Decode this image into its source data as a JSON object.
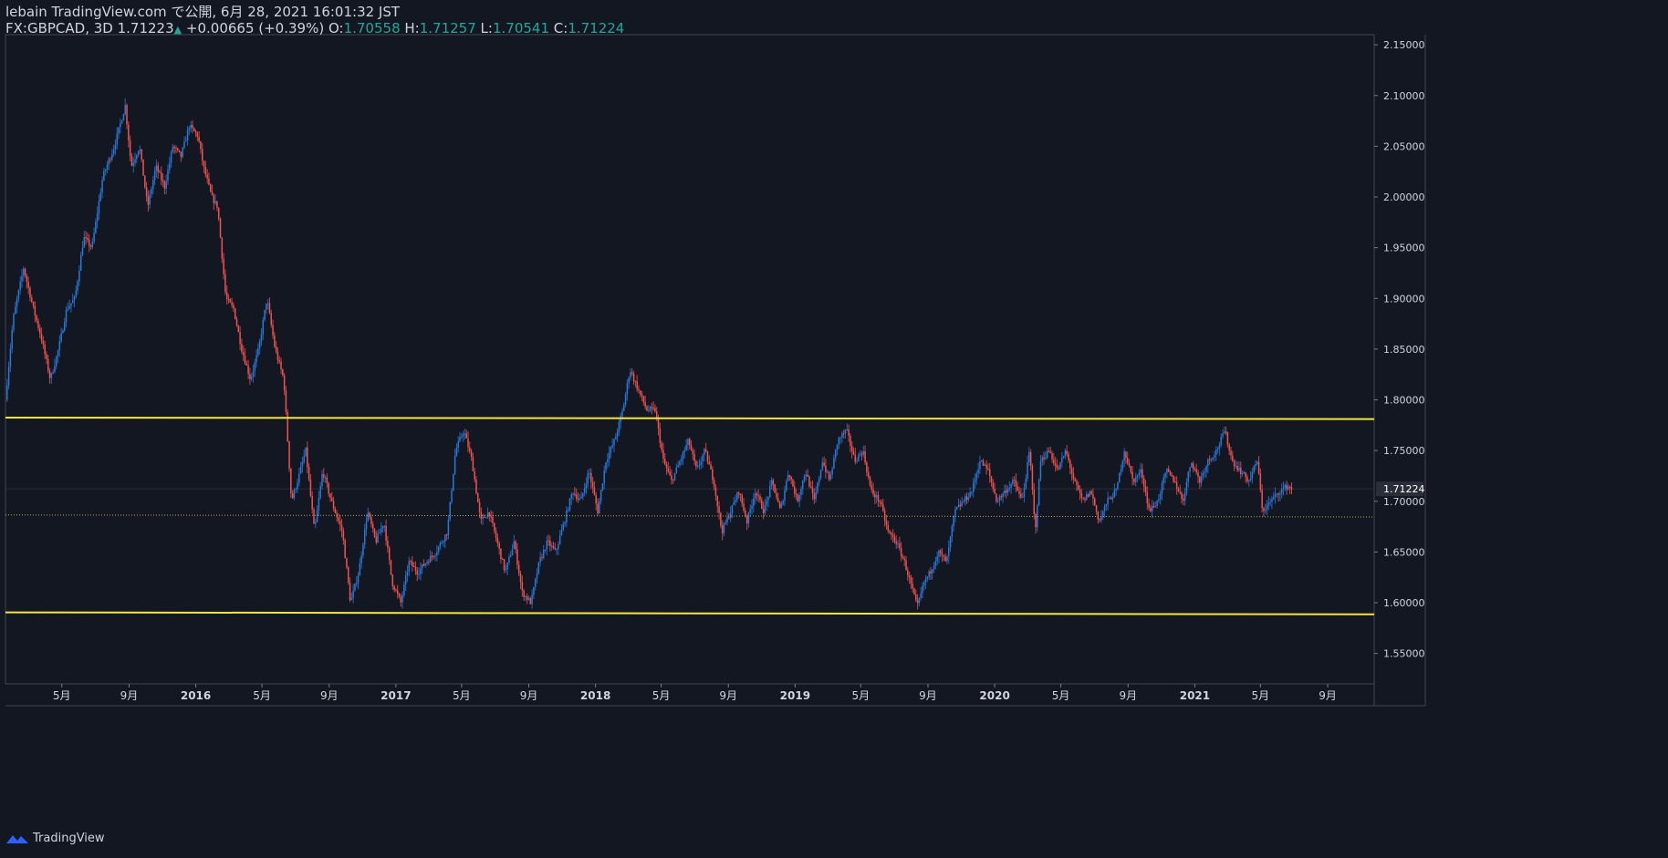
{
  "header": {
    "line1": "lebain TradingView.com で公開, 6月 28, 2021 16:01:32 JST",
    "symbol": "FX:GBPCAD, 3D 1.71223",
    "change": "+0.00665 (+0.39%)",
    "o_label": "O:",
    "o_value": "1.70558",
    "h_label": "H:",
    "h_value": "1.71257",
    "l_label": "L:",
    "l_value": "1.70541",
    "c_label": "C:",
    "c_value": "1.71224"
  },
  "footer": {
    "brand": "TradingView"
  },
  "colors": {
    "background": "#131722",
    "up": "#2979d8",
    "down": "#ef5350",
    "level_line": "#f5e642",
    "axis_text": "#d1d4dc",
    "price_tag": "#2a2e39"
  },
  "chart_data": {
    "type": "candlestick",
    "title": "",
    "symbol": "FX:GBPCAD",
    "timeframe": "3D",
    "ylim": [
      1.52,
      2.16
    ],
    "y_ticks": [
      1.55,
      1.6,
      1.65,
      1.7,
      1.75,
      1.8,
      1.85,
      1.9,
      1.95,
      2.0,
      2.05,
      2.1,
      2.15
    ],
    "y_tick_labels": [
      "1.55000",
      "1.60000",
      "1.65000",
      "1.70000",
      "1.75000",
      "1.80000",
      "1.85000",
      "1.90000",
      "1.95000",
      "2.00000",
      "2.05000",
      "2.10000",
      "2.15000"
    ],
    "xlim": [
      "2015-01-18",
      "2021-11-25"
    ],
    "x_ticks": [
      {
        "date": "2015-05-01",
        "label": "5月"
      },
      {
        "date": "2015-09-01",
        "label": "9月"
      },
      {
        "date": "2016-01-01",
        "label": "2016"
      },
      {
        "date": "2016-05-01",
        "label": "5月"
      },
      {
        "date": "2016-09-01",
        "label": "9月"
      },
      {
        "date": "2017-01-01",
        "label": "2017"
      },
      {
        "date": "2017-05-01",
        "label": "5月"
      },
      {
        "date": "2017-09-01",
        "label": "9月"
      },
      {
        "date": "2018-01-01",
        "label": "2018"
      },
      {
        "date": "2018-05-01",
        "label": "5月"
      },
      {
        "date": "2018-09-01",
        "label": "9月"
      },
      {
        "date": "2019-01-01",
        "label": "2019"
      },
      {
        "date": "2019-05-01",
        "label": "5月"
      },
      {
        "date": "2019-09-01",
        "label": "9月"
      },
      {
        "date": "2020-01-01",
        "label": "2020"
      },
      {
        "date": "2020-05-01",
        "label": "5月"
      },
      {
        "date": "2020-09-01",
        "label": "9月"
      },
      {
        "date": "2021-01-01",
        "label": "2021"
      },
      {
        "date": "2021-05-01",
        "label": "5月"
      },
      {
        "date": "2021-09-01",
        "label": "9月"
      }
    ],
    "last_price": 1.71224,
    "last_price_label": "1.71224",
    "horizontal_levels": [
      {
        "price": 1.7825,
        "end_price": 1.781,
        "style": "solid",
        "color": "#f5e642"
      },
      {
        "price": 1.5905,
        "end_price": 1.5885,
        "style": "solid",
        "color": "#f5e642"
      },
      {
        "price": 1.6865,
        "end_price": 1.6845,
        "style": "dotted",
        "color": "#b8a94a"
      }
    ],
    "close_path": [
      [
        "2015-01-18",
        1.8
      ],
      [
        "2015-02-01",
        1.88
      ],
      [
        "2015-02-20",
        1.93
      ],
      [
        "2015-03-10",
        1.89
      ],
      [
        "2015-03-25",
        1.86
      ],
      [
        "2015-04-10",
        1.82
      ],
      [
        "2015-04-25",
        1.85
      ],
      [
        "2015-05-10",
        1.89
      ],
      [
        "2015-05-25",
        1.9
      ],
      [
        "2015-06-10",
        1.96
      ],
      [
        "2015-06-25",
        1.95
      ],
      [
        "2015-07-15",
        2.02
      ],
      [
        "2015-08-05",
        2.05
      ],
      [
        "2015-08-25",
        2.09
      ],
      [
        "2015-09-05",
        2.03
      ],
      [
        "2015-09-20",
        2.05
      ],
      [
        "2015-10-05",
        1.99
      ],
      [
        "2015-10-20",
        2.03
      ],
      [
        "2015-11-05",
        2.01
      ],
      [
        "2015-11-20",
        2.05
      ],
      [
        "2015-12-05",
        2.04
      ],
      [
        "2015-12-20",
        2.07
      ],
      [
        "2016-01-05",
        2.06
      ],
      [
        "2016-01-15",
        2.03
      ],
      [
        "2016-01-30",
        2.0
      ],
      [
        "2016-02-10",
        1.99
      ],
      [
        "2016-02-25",
        1.9
      ],
      [
        "2016-03-10",
        1.89
      ],
      [
        "2016-03-25",
        1.85
      ],
      [
        "2016-04-10",
        1.82
      ],
      [
        "2016-04-25",
        1.85
      ],
      [
        "2016-05-10",
        1.9
      ],
      [
        "2016-05-25",
        1.85
      ],
      [
        "2016-06-10",
        1.82
      ],
      [
        "2016-06-24",
        1.7
      ],
      [
        "2016-07-05",
        1.72
      ],
      [
        "2016-07-20",
        1.75
      ],
      [
        "2016-08-05",
        1.67
      ],
      [
        "2016-08-20",
        1.73
      ],
      [
        "2016-09-05",
        1.7
      ],
      [
        "2016-09-25",
        1.67
      ],
      [
        "2016-10-10",
        1.6
      ],
      [
        "2016-10-25",
        1.63
      ],
      [
        "2016-11-10",
        1.69
      ],
      [
        "2016-11-25",
        1.66
      ],
      [
        "2016-12-10",
        1.68
      ],
      [
        "2016-12-25",
        1.62
      ],
      [
        "2017-01-10",
        1.6
      ],
      [
        "2017-01-25",
        1.64
      ],
      [
        "2017-02-10",
        1.63
      ],
      [
        "2017-02-25",
        1.64
      ],
      [
        "2017-03-15",
        1.65
      ],
      [
        "2017-04-05",
        1.67
      ],
      [
        "2017-04-20",
        1.75
      ],
      [
        "2017-05-05",
        1.77
      ],
      [
        "2017-05-20",
        1.74
      ],
      [
        "2017-06-05",
        1.68
      ],
      [
        "2017-06-20",
        1.69
      ],
      [
        "2017-07-05",
        1.66
      ],
      [
        "2017-07-20",
        1.63
      ],
      [
        "2017-08-05",
        1.66
      ],
      [
        "2017-08-20",
        1.61
      ],
      [
        "2017-09-05",
        1.6
      ],
      [
        "2017-09-20",
        1.64
      ],
      [
        "2017-10-05",
        1.66
      ],
      [
        "2017-10-20",
        1.65
      ],
      [
        "2017-11-05",
        1.68
      ],
      [
        "2017-11-20",
        1.71
      ],
      [
        "2017-12-05",
        1.7
      ],
      [
        "2017-12-20",
        1.73
      ],
      [
        "2018-01-05",
        1.69
      ],
      [
        "2018-01-20",
        1.74
      ],
      [
        "2018-02-05",
        1.76
      ],
      [
        "2018-02-20",
        1.79
      ],
      [
        "2018-03-05",
        1.83
      ],
      [
        "2018-03-20",
        1.81
      ],
      [
        "2018-04-05",
        1.79
      ],
      [
        "2018-04-20",
        1.79
      ],
      [
        "2018-05-05",
        1.74
      ],
      [
        "2018-05-20",
        1.72
      ],
      [
        "2018-06-05",
        1.74
      ],
      [
        "2018-06-20",
        1.76
      ],
      [
        "2018-07-05",
        1.73
      ],
      [
        "2018-07-20",
        1.75
      ],
      [
        "2018-08-05",
        1.72
      ],
      [
        "2018-08-20",
        1.67
      ],
      [
        "2018-09-05",
        1.69
      ],
      [
        "2018-09-20",
        1.71
      ],
      [
        "2018-10-05",
        1.68
      ],
      [
        "2018-10-20",
        1.71
      ],
      [
        "2018-11-05",
        1.69
      ],
      [
        "2018-11-20",
        1.72
      ],
      [
        "2018-12-05",
        1.69
      ],
      [
        "2018-12-20",
        1.73
      ],
      [
        "2019-01-05",
        1.7
      ],
      [
        "2019-01-20",
        1.73
      ],
      [
        "2019-02-05",
        1.7
      ],
      [
        "2019-02-20",
        1.74
      ],
      [
        "2019-03-05",
        1.72
      ],
      [
        "2019-03-20",
        1.76
      ],
      [
        "2019-04-05",
        1.77
      ],
      [
        "2019-04-20",
        1.74
      ],
      [
        "2019-05-05",
        1.75
      ],
      [
        "2019-05-20",
        1.71
      ],
      [
        "2019-06-05",
        1.7
      ],
      [
        "2019-06-20",
        1.67
      ],
      [
        "2019-07-05",
        1.66
      ],
      [
        "2019-07-20",
        1.64
      ],
      [
        "2019-08-05",
        1.61
      ],
      [
        "2019-08-12",
        1.595
      ],
      [
        "2019-08-25",
        1.62
      ],
      [
        "2019-09-05",
        1.63
      ],
      [
        "2019-09-20",
        1.65
      ],
      [
        "2019-10-05",
        1.64
      ],
      [
        "2019-10-20",
        1.69
      ],
      [
        "2019-11-05",
        1.7
      ],
      [
        "2019-11-20",
        1.71
      ],
      [
        "2019-12-05",
        1.74
      ],
      [
        "2019-12-20",
        1.73
      ],
      [
        "2020-01-05",
        1.7
      ],
      [
        "2020-01-20",
        1.71
      ],
      [
        "2020-02-05",
        1.72
      ],
      [
        "2020-02-20",
        1.7
      ],
      [
        "2020-03-05",
        1.75
      ],
      [
        "2020-03-15",
        1.67
      ],
      [
        "2020-03-25",
        1.74
      ],
      [
        "2020-04-10",
        1.75
      ],
      [
        "2020-04-25",
        1.73
      ],
      [
        "2020-05-10",
        1.75
      ],
      [
        "2020-05-25",
        1.72
      ],
      [
        "2020-06-10",
        1.7
      ],
      [
        "2020-06-25",
        1.71
      ],
      [
        "2020-07-10",
        1.68
      ],
      [
        "2020-07-25",
        1.7
      ],
      [
        "2020-08-10",
        1.71
      ],
      [
        "2020-08-25",
        1.75
      ],
      [
        "2020-09-10",
        1.72
      ],
      [
        "2020-09-25",
        1.73
      ],
      [
        "2020-10-10",
        1.69
      ],
      [
        "2020-10-25",
        1.7
      ],
      [
        "2020-11-10",
        1.73
      ],
      [
        "2020-11-25",
        1.72
      ],
      [
        "2020-12-10",
        1.7
      ],
      [
        "2020-12-25",
        1.74
      ],
      [
        "2021-01-10",
        1.72
      ],
      [
        "2021-01-25",
        1.74
      ],
      [
        "2021-02-10",
        1.75
      ],
      [
        "2021-02-25",
        1.77
      ],
      [
        "2021-03-10",
        1.74
      ],
      [
        "2021-03-25",
        1.73
      ],
      [
        "2021-04-10",
        1.72
      ],
      [
        "2021-04-25",
        1.74
      ],
      [
        "2021-05-05",
        1.69
      ],
      [
        "2021-05-20",
        1.7
      ],
      [
        "2021-06-05",
        1.71
      ],
      [
        "2021-06-20",
        1.715
      ],
      [
        "2021-06-28",
        1.712
      ]
    ]
  }
}
